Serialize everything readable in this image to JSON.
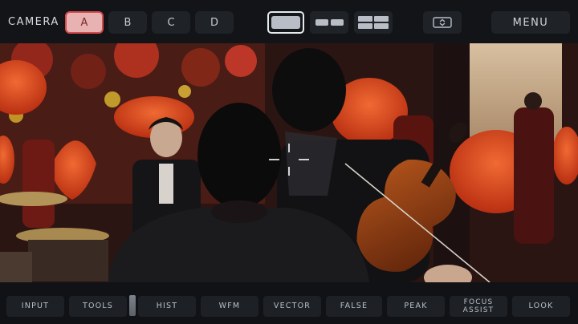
{
  "top_bar": {
    "camera_label": "CAMERA",
    "cameras": [
      {
        "label": "A",
        "active": true
      },
      {
        "label": "B",
        "active": false
      },
      {
        "label": "C",
        "active": false
      },
      {
        "label": "D",
        "active": false
      }
    ],
    "layouts": [
      {
        "name": "single-view",
        "active": true
      },
      {
        "name": "dual-view",
        "active": false
      },
      {
        "name": "quad-view",
        "active": false
      }
    ],
    "swap_icon": "swap-arrows-icon",
    "menu_label": "MENU"
  },
  "viewport": {
    "reticle_icon": "focus-reticle-icon",
    "colors": {
      "umbrella_red": "#d8461c",
      "backdrop": "#3a1a18",
      "violin": "#8a3a12"
    }
  },
  "bottom_bar": {
    "tools": [
      {
        "label": "INPUT"
      },
      {
        "label": "TOOLS"
      },
      {
        "label": "HIST"
      },
      {
        "label": "WFM"
      },
      {
        "label": "VECTOR"
      },
      {
        "label": "FALSE"
      },
      {
        "label": "PEAK"
      },
      {
        "label": "FOCUS",
        "label2": "ASSIST"
      },
      {
        "label": "LOOK"
      }
    ]
  }
}
